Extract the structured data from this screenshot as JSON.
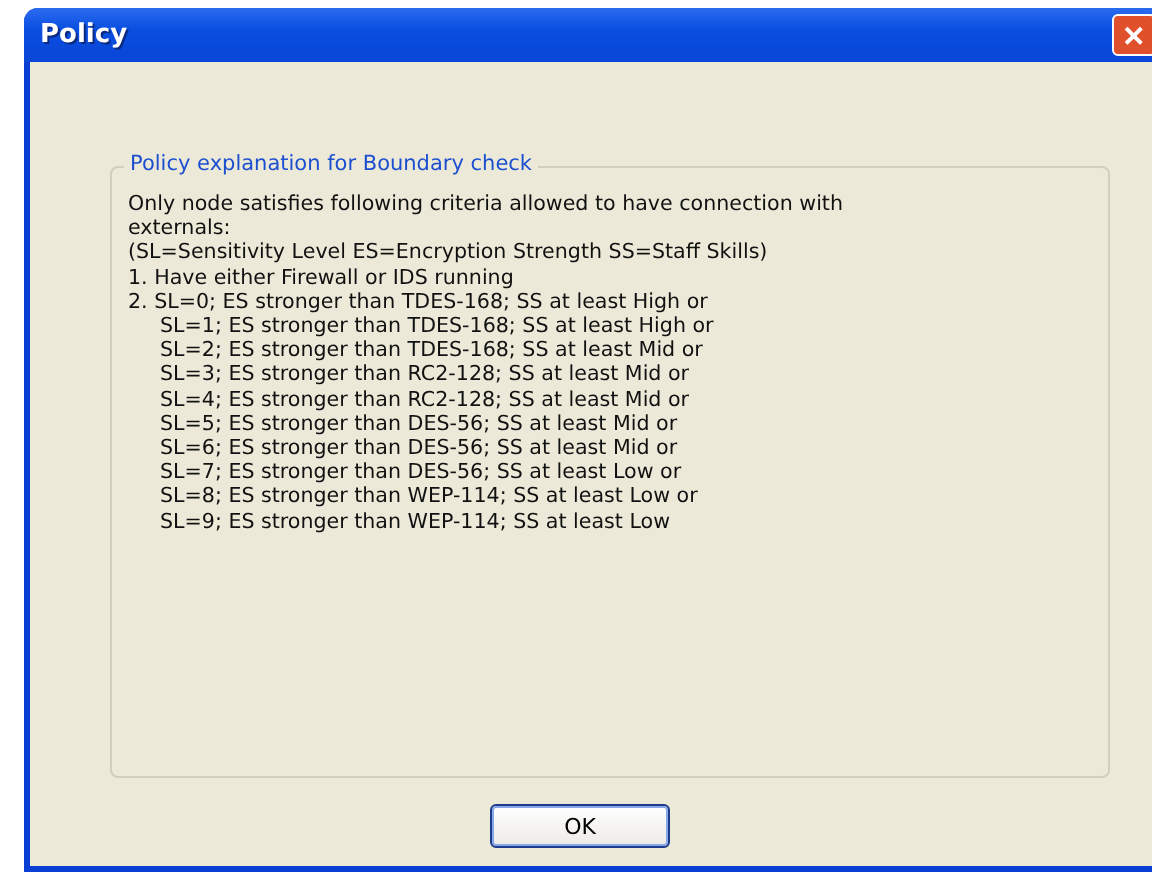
{
  "window": {
    "title": "Policy",
    "close_glyph": "✕"
  },
  "group": {
    "title": "Policy explanation for Boundary check",
    "lines": [
      {
        "kind": "plain",
        "text": "Only node satisfies following criteria allowed to have connection with"
      },
      {
        "kind": "plain",
        "text": "externals:"
      },
      {
        "kind": "plain",
        "text": "(SL=Sensitivity Level ES=Encryption Strength SS=Staff Skills)"
      },
      {
        "kind": "plain",
        "text": "1. Have either Firewall or IDS running"
      },
      {
        "kind": "plain",
        "text": "2. SL=0; ES stronger than TDES-168; SS at least High or"
      },
      {
        "kind": "sub",
        "text": "SL=1; ES stronger than TDES-168; SS at least High or"
      },
      {
        "kind": "sub",
        "text": "SL=2; ES stronger than TDES-168; SS at least Mid or"
      },
      {
        "kind": "sub",
        "text": "SL=3; ES stronger than RC2-128; SS at least Mid or"
      },
      {
        "kind": "sub",
        "text": "SL=4; ES stronger than RC2-128; SS at least Mid or"
      },
      {
        "kind": "sub",
        "text": "SL=5; ES stronger than DES-56; SS at least Mid or"
      },
      {
        "kind": "sub",
        "text": "SL=6; ES stronger than DES-56; SS at least Mid or"
      },
      {
        "kind": "sub",
        "text": "SL=7; ES stronger than DES-56; SS at least Low or"
      },
      {
        "kind": "sub",
        "text": "SL=8; ES stronger than WEP-114; SS at least Low or"
      },
      {
        "kind": "sub",
        "text": "SL=9; ES stronger than WEP-114; SS at least Low"
      }
    ]
  },
  "buttons": [
    {
      "label": "OK"
    }
  ]
}
